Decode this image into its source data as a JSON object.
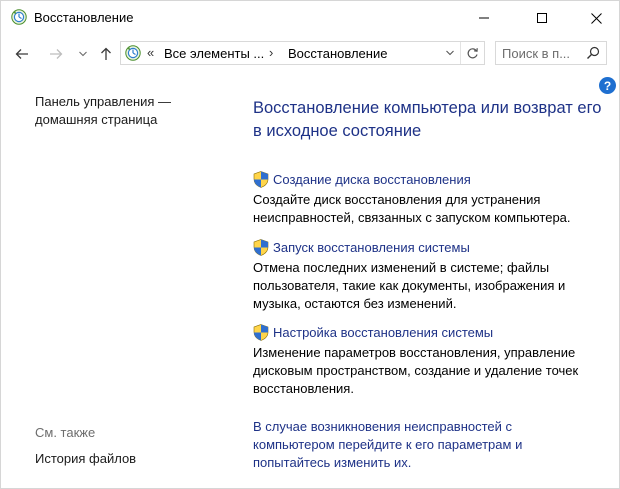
{
  "window": {
    "title": "Восстановление",
    "icons": {
      "app": "recovery-icon",
      "minimize": "minimize-icon",
      "maximize": "maximize-icon",
      "close": "close-icon"
    }
  },
  "nav": {
    "address": {
      "overflow": "«",
      "crumb1": "Все элементы ...",
      "separator": "›",
      "crumb2": "Восстановление"
    },
    "search": {
      "placeholder": "Поиск в п..."
    }
  },
  "help": {
    "label": "?"
  },
  "sidebar": {
    "home_link": "Панель управления — домашняя страница",
    "see_also": "См. также",
    "file_history": "История файлов"
  },
  "main": {
    "heading": "Восстановление компьютера или возврат его в исходное состояние",
    "tasks": [
      {
        "link": "Создание диска восстановления",
        "desc": "Создайте диск восстановления для устранения неисправностей, связанных с запуском компьютера."
      },
      {
        "link": "Запуск восстановления системы",
        "desc": "Отмена последних изменений в системе; файлы пользователя, такие как документы, изображения и музыка, остаются без изменений."
      },
      {
        "link": "Настройка восстановления системы",
        "desc": "Изменение параметров восстановления, управление дисковым пространством, создание и удаление точек восстановления."
      }
    ],
    "troubleshoot": "В случае возникновения неисправностей с компьютером перейдите к его параметрам и попытайтесь изменить их."
  },
  "colors": {
    "link": "#1e3287",
    "help": "#1e6fd0",
    "muted": "#6d6d6d"
  }
}
